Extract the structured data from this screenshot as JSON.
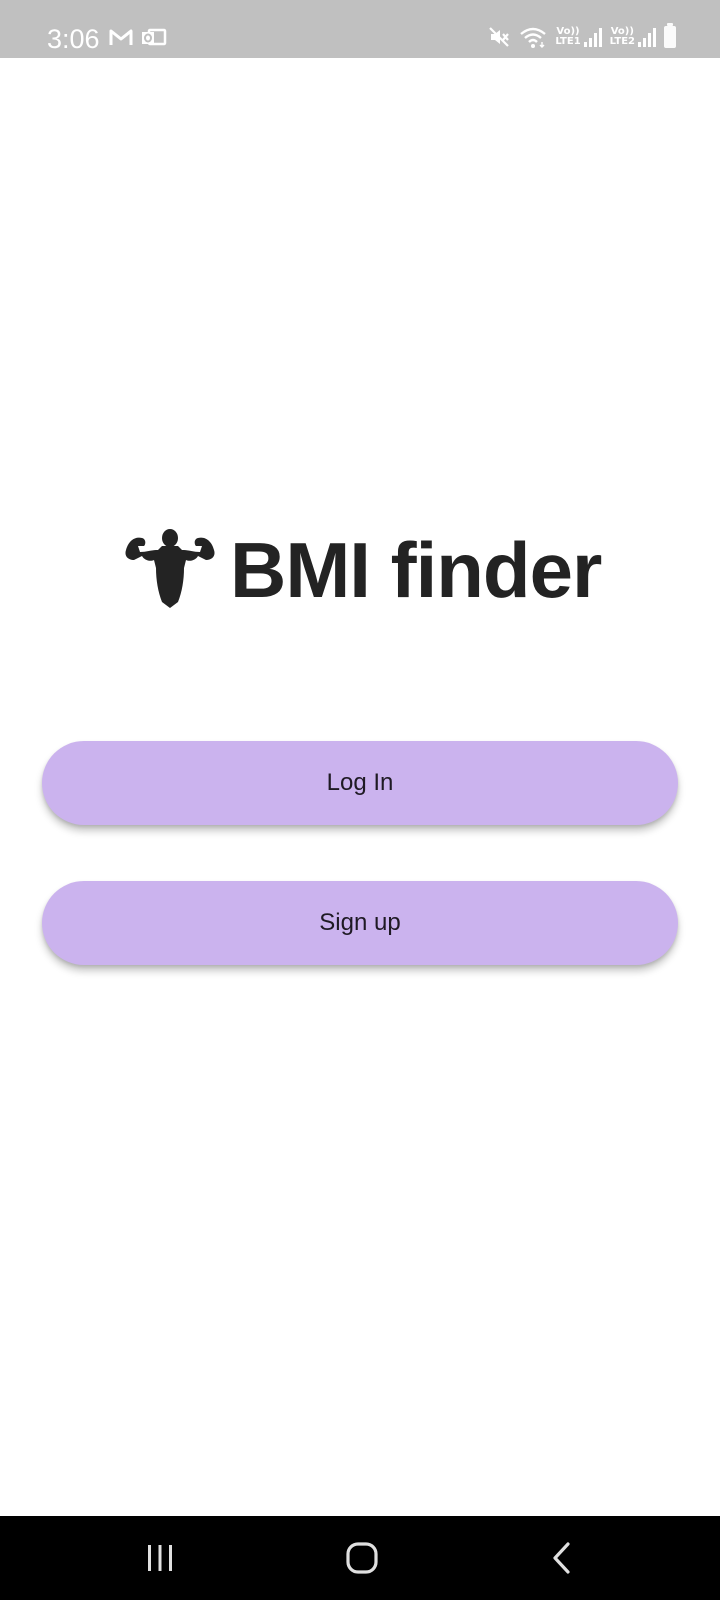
{
  "status_bar": {
    "time": "3:06",
    "sim1_volte": "Vo))",
    "sim1_label": "LTE1",
    "sim2_volte": "Vo))",
    "sim2_label": "LTE2",
    "left_icons": [
      "gmail-icon",
      "outlook-icon"
    ],
    "right_icons": [
      "mute-icon",
      "wifi-icon",
      "signal-icon",
      "signal-icon",
      "battery-icon"
    ]
  },
  "brand": {
    "name": "BMI finder",
    "logo_icon": "bodybuilder-icon"
  },
  "buttons": {
    "login_label": "Log In",
    "signup_label": "Sign up"
  },
  "nav_bar": {
    "icons": [
      "recents-icon",
      "home-icon",
      "back-icon"
    ]
  },
  "colors": {
    "status_bar_bg": "#c0c0c0",
    "button_bg": "#cbb3ee",
    "brand_text": "#232323",
    "nav_bar_bg": "#000000"
  }
}
